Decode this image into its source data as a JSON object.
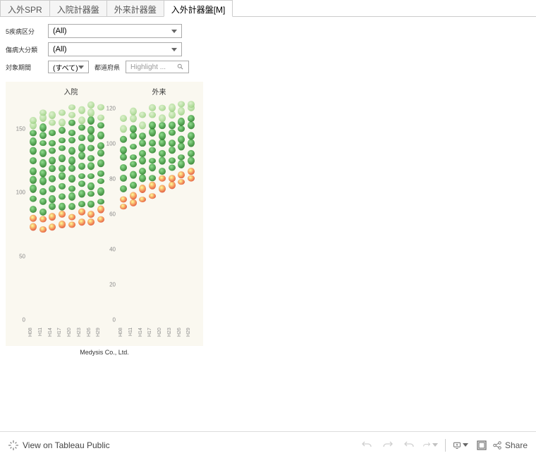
{
  "tabs": [
    {
      "label": "入外SPR",
      "active": false
    },
    {
      "label": "入院計器盤",
      "active": false
    },
    {
      "label": "外来計器盤",
      "active": false
    },
    {
      "label": "入外計器盤[M]",
      "active": true
    }
  ],
  "filters": {
    "category5": {
      "label": "5疾病区分",
      "value": "(All)"
    },
    "disease": {
      "label": "傷病大分類",
      "value": "(All)"
    },
    "period": {
      "label": "対象期間",
      "value": "(すべて)"
    },
    "prefecture": {
      "label": "都道府県",
      "placeholder": "Highlight ..."
    }
  },
  "chart_data": {
    "type": "scatter",
    "panels": [
      {
        "title": "入院",
        "ylim": [
          0,
          180
        ],
        "yticks": [
          0,
          50,
          100,
          150
        ],
        "categories": [
          "H08",
          "H11",
          "H14",
          "H17",
          "H20",
          "H23",
          "H26",
          "H29"
        ],
        "series_range": {
          "low": 75,
          "high": 170
        },
        "clusters": [
          {
            "x": "H08",
            "vals": [
              78,
              85,
              92,
              100,
              108,
              115,
              122,
              130,
              138,
              145,
              152,
              158,
              162
            ]
          },
          {
            "x": "H11",
            "vals": [
              76,
              84,
              90,
              98,
              106,
              114,
              120,
              128,
              136,
              144,
              150,
              156,
              164,
              168
            ]
          },
          {
            "x": "H14",
            "vals": [
              78,
              86,
              94,
              100,
              108,
              116,
              124,
              130,
              138,
              144,
              152,
              160,
              166
            ]
          },
          {
            "x": "H17",
            "vals": [
              80,
              88,
              94,
              102,
              110,
              118,
              124,
              132,
              140,
              146,
              154,
              160,
              168
            ]
          },
          {
            "x": "H20",
            "vals": [
              80,
              86,
              94,
              102,
              108,
              116,
              124,
              130,
              138,
              146,
              152,
              160,
              166,
              172
            ]
          },
          {
            "x": "H23",
            "vals": [
              82,
              90,
              96,
              104,
              112,
              118,
              126,
              134,
              140,
              148,
              156,
              162,
              170
            ]
          },
          {
            "x": "H26",
            "vals": [
              82,
              88,
              96,
              104,
              110,
              118,
              126,
              132,
              140,
              148,
              154,
              162,
              168,
              174
            ]
          },
          {
            "x": "H29",
            "vals": [
              84,
              92,
              98,
              106,
              114,
              120,
              128,
              136,
              142,
              150,
              158,
              164,
              172
            ]
          }
        ]
      },
      {
        "title": "外来",
        "ylim": [
          0,
          130
        ],
        "yticks": [
          0,
          20,
          40,
          60,
          80,
          100,
          120
        ],
        "categories": [
          "H08",
          "H11",
          "H14",
          "H17",
          "H20",
          "H23",
          "H26",
          "H29"
        ],
        "series_range": {
          "low": 68,
          "high": 125
        },
        "clusters": [
          {
            "x": "H08",
            "vals": [
              68,
              72,
              78,
              84,
              90,
              96,
              100,
              106,
              112,
              118
            ]
          },
          {
            "x": "H11",
            "vals": [
              70,
              74,
              80,
              86,
              92,
              96,
              102,
              108,
              112,
              118,
              122
            ]
          },
          {
            "x": "H14",
            "vals": [
              72,
              78,
              84,
              88,
              94,
              98,
              104,
              108,
              114,
              120
            ]
          },
          {
            "x": "H17",
            "vals": [
              74,
              80,
              84,
              90,
              94,
              100,
              104,
              110,
              114,
              120,
              124
            ]
          },
          {
            "x": "H20",
            "vals": [
              78,
              84,
              88,
              94,
              98,
              104,
              108,
              114,
              118,
              124
            ]
          },
          {
            "x": "H23",
            "vals": [
              80,
              84,
              90,
              94,
              100,
              104,
              110,
              114,
              120,
              124
            ]
          },
          {
            "x": "H26",
            "vals": [
              82,
              86,
              92,
              96,
              102,
              106,
              112,
              116,
              122,
              126
            ]
          },
          {
            "x": "H29",
            "vals": [
              84,
              88,
              94,
              98,
              104,
              108,
              114,
              118,
              124,
              126
            ]
          }
        ]
      }
    ]
  },
  "credit": "Medysis Co., Ltd.",
  "toolbar": {
    "view_label": "View on Tableau Public",
    "share_label": "Share"
  }
}
